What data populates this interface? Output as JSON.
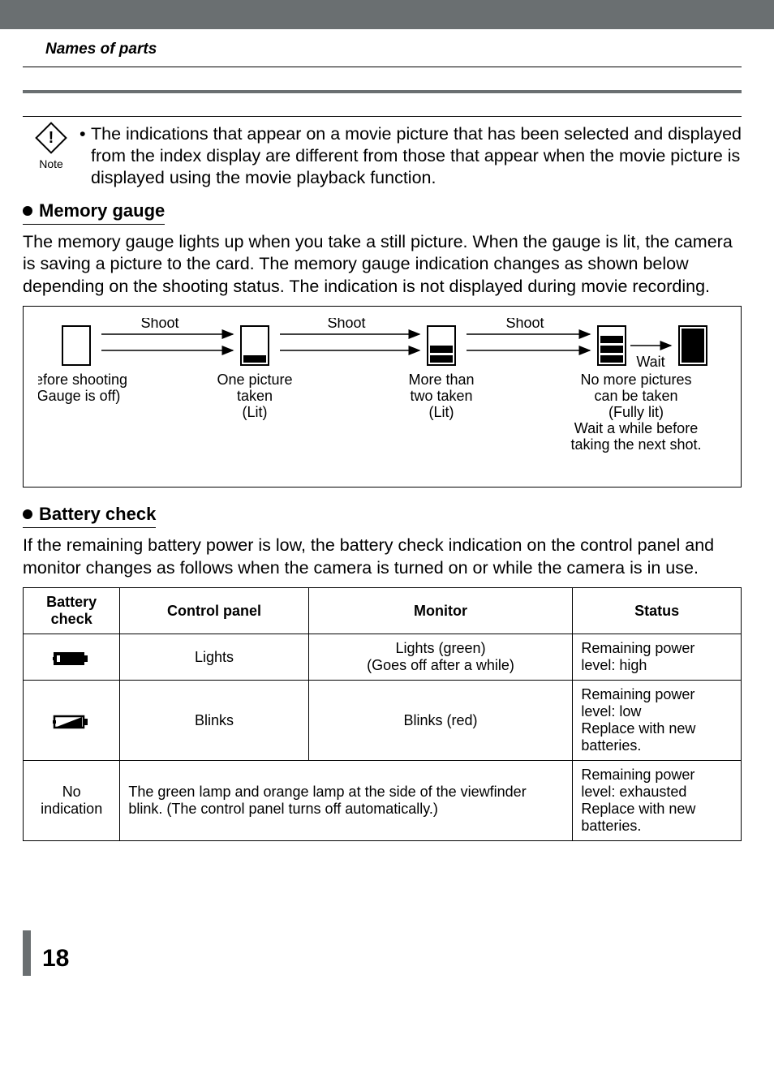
{
  "sectionName": "Names of parts",
  "note": {
    "iconLabel": "Note",
    "text": "The indications that appear on a movie picture that has been selected and displayed from the index display are different from those that appear when the movie picture is displayed using the movie playback function."
  },
  "memoryGauge": {
    "heading": "Memory gauge",
    "para": "The memory gauge lights up when you take a still picture. When the gauge is lit, the camera is saving a picture to the card. The memory gauge indication changes as shown below depending on the shooting status. The indication is not displayed during movie recording.",
    "arrows": {
      "shoot": "Shoot",
      "wait": "Wait"
    },
    "stages": [
      {
        "line1": "Before shooting",
        "line2": "(Gauge is off)",
        "line3": "",
        "line4": "",
        "line5": ""
      },
      {
        "line1": "One picture",
        "line2": "taken",
        "line3": "(Lit)",
        "line4": "",
        "line5": ""
      },
      {
        "line1": "More than",
        "line2": "two taken",
        "line3": "(Lit)",
        "line4": "",
        "line5": ""
      },
      {
        "line1": "No more pictures",
        "line2": "can be taken",
        "line3": "(Fully lit)",
        "line4": "Wait a while before",
        "line5": "taking the next shot."
      }
    ]
  },
  "batteryCheck": {
    "heading": "Battery check",
    "para": "If the remaining battery power is low, the battery check indication on the control panel and monitor changes as follows when the camera is turned on or while the camera is in use.",
    "headers": {
      "c1": "Battery check",
      "c2": "Control panel",
      "c3": "Monitor",
      "c4": "Status"
    },
    "rows": [
      {
        "panel": "Lights",
        "monitor": "Lights (green)\n(Goes off after a while)",
        "status": "Remaining power level: high"
      },
      {
        "panel": "Blinks",
        "monitor": "Blinks (red)",
        "status": "Remaining power level: low\nReplace with new batteries."
      },
      {
        "check": "No indication",
        "merged": "The green lamp and orange lamp at the side of the viewfinder blink. (The control panel turns off automatically.)",
        "status": "Remaining power level: exhausted\nReplace with new batteries."
      }
    ]
  },
  "pageNumber": "18"
}
